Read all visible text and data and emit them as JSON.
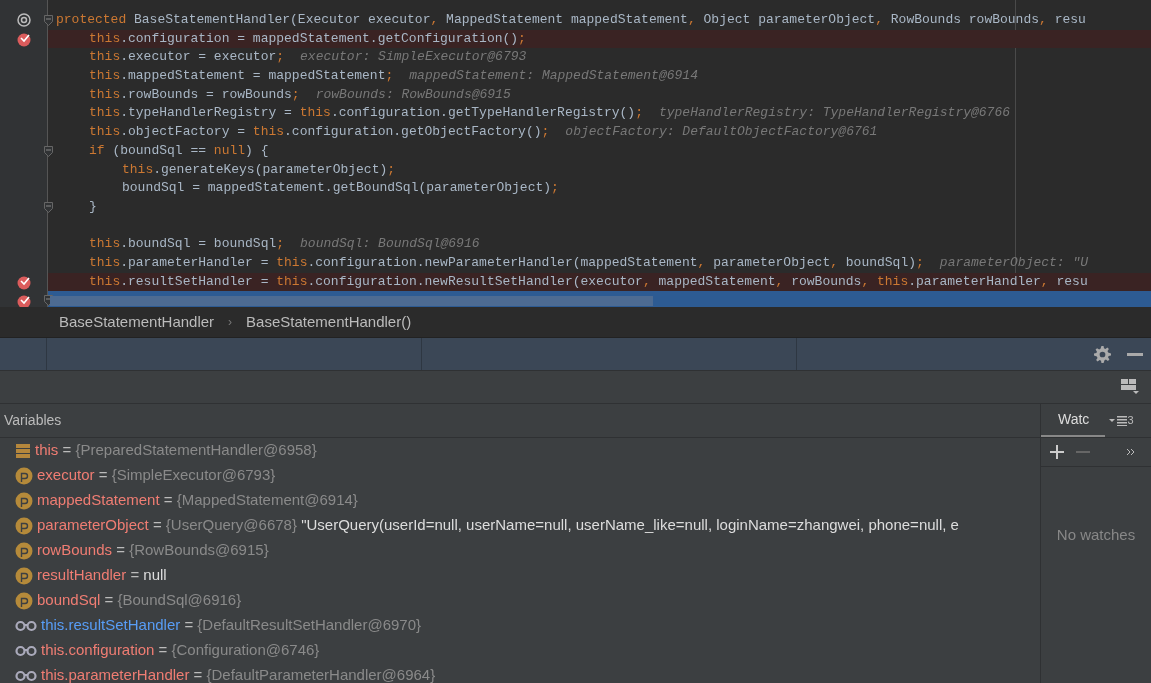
{
  "editor": {
    "lines": [
      {
        "implements": true,
        "breakpoint": false,
        "current": false,
        "fold": true,
        "segments": [
          {
            "text": "protected",
            "kind": "kw"
          },
          {
            "text": " BaseStatementHandler(Executor executor",
            "kind": "tx"
          },
          {
            "text": ",",
            "kind": "kw"
          },
          {
            "text": " MappedStatement mappedStatement",
            "kind": "tx"
          },
          {
            "text": ",",
            "kind": "kw"
          },
          {
            "text": " Object parameterObject",
            "kind": "tx"
          },
          {
            "text": ",",
            "kind": "kw"
          },
          {
            "text": " RowBounds rowBounds",
            "kind": "tx"
          },
          {
            "text": ",",
            "kind": "kw"
          },
          {
            "text": " resu",
            "kind": "tx"
          }
        ],
        "children": [
          {
            "implements": false,
            "breakpoint": true,
            "current": false,
            "fold": false,
            "segments": [
              {
                "text": "this",
                "kind": "kw"
              },
              {
                "text": ".configuration = mappedStatement.getConfiguration()",
                "kind": "tx"
              },
              {
                "text": ";",
                "kind": "kw"
              }
            ]
          },
          {
            "implements": false,
            "breakpoint": false,
            "current": false,
            "fold": false,
            "segments": [
              {
                "text": "this",
                "kind": "kw"
              },
              {
                "text": ".executor = executor",
                "kind": "tx"
              },
              {
                "text": ";",
                "kind": "kw"
              }
            ],
            "hint": "executor: SimpleExecutor@6793"
          },
          {
            "implements": false,
            "breakpoint": false,
            "current": false,
            "fold": false,
            "segments": [
              {
                "text": "this",
                "kind": "kw"
              },
              {
                "text": ".mappedStatement = mappedStatement",
                "kind": "tx"
              },
              {
                "text": ";",
                "kind": "kw"
              }
            ],
            "hint": "mappedStatement: MappedStatement@6914"
          },
          {
            "implements": false,
            "breakpoint": false,
            "current": false,
            "fold": false,
            "segments": [
              {
                "text": "this",
                "kind": "kw"
              },
              {
                "text": ".rowBounds = rowBounds",
                "kind": "tx"
              },
              {
                "text": ";",
                "kind": "kw"
              }
            ],
            "hint": "rowBounds: RowBounds@6915"
          },
          {
            "implements": false,
            "breakpoint": false,
            "current": false,
            "fold": false,
            "segments": [
              {
                "text": "this",
                "kind": "kw"
              },
              {
                "text": ".typeHandlerRegistry = ",
                "kind": "tx"
              },
              {
                "text": "this",
                "kind": "kw"
              },
              {
                "text": ".configuration.getTypeHandlerRegistry()",
                "kind": "tx"
              },
              {
                "text": ";",
                "kind": "kw"
              }
            ],
            "hint": "typeHandlerRegistry: TypeHandlerRegistry@6766"
          },
          {
            "implements": false,
            "breakpoint": false,
            "current": false,
            "fold": false,
            "segments": [
              {
                "text": "this",
                "kind": "kw"
              },
              {
                "text": ".objectFactory = ",
                "kind": "tx"
              },
              {
                "text": "this",
                "kind": "kw"
              },
              {
                "text": ".configuration.getObjectFactory()",
                "kind": "tx"
              },
              {
                "text": ";",
                "kind": "kw"
              }
            ],
            "hint": "objectFactory: DefaultObjectFactory@6761"
          },
          {
            "implements": false,
            "breakpoint": false,
            "current": false,
            "fold": true,
            "segments": [
              {
                "text": "if",
                "kind": "kw"
              },
              {
                "text": " (boundSql == ",
                "kind": "tx"
              },
              {
                "text": "null",
                "kind": "kw"
              },
              {
                "text": ") {",
                "kind": "tx"
              }
            ],
            "children": [
              {
                "implements": false,
                "breakpoint": false,
                "current": false,
                "fold": false,
                "segments": [
                  {
                    "text": "this",
                    "kind": "kw"
                  },
                  {
                    "text": ".generateKeys(parameterObject)",
                    "kind": "tx"
                  },
                  {
                    "text": ";",
                    "kind": "kw"
                  }
                ]
              },
              {
                "implements": false,
                "breakpoint": false,
                "current": false,
                "fold": false,
                "segments": [
                  {
                    "text": "boundSql = mappedStatement.getBoundSql(parameterObject)",
                    "kind": "tx"
                  },
                  {
                    "text": ";",
                    "kind": "kw"
                  }
                ]
              }
            ]
          },
          {
            "implements": false,
            "breakpoint": false,
            "current": false,
            "fold": true,
            "segments": [
              {
                "text": "}",
                "kind": "tx"
              }
            ]
          },
          {
            "implements": false,
            "breakpoint": false,
            "current": false,
            "fold": false
          },
          {
            "implements": false,
            "breakpoint": false,
            "current": false,
            "fold": false,
            "segments": [
              {
                "text": "this",
                "kind": "kw"
              },
              {
                "text": ".boundSql = boundSql",
                "kind": "tx"
              },
              {
                "text": ";",
                "kind": "kw"
              }
            ],
            "hint": "boundSql: BoundSql@6916"
          },
          {
            "implements": false,
            "breakpoint": false,
            "current": false,
            "fold": false,
            "segments": [
              {
                "text": "this",
                "kind": "kw"
              },
              {
                "text": ".parameterHandler = ",
                "kind": "tx"
              },
              {
                "text": "this",
                "kind": "kw"
              },
              {
                "text": ".configuration.newParameterHandler(mappedStatement",
                "kind": "tx"
              },
              {
                "text": ",",
                "kind": "kw"
              },
              {
                "text": " parameterObject",
                "kind": "tx"
              },
              {
                "text": ",",
                "kind": "kw"
              },
              {
                "text": " boundSql)",
                "kind": "tx"
              },
              {
                "text": ";",
                "kind": "kw"
              }
            ],
            "hint": "parameterObject: \"U"
          },
          {
            "implements": false,
            "breakpoint": true,
            "current": false,
            "fold": false,
            "segments": [
              {
                "text": "this",
                "kind": "kw"
              },
              {
                "text": ".resultSetHandler = ",
                "kind": "tx"
              },
              {
                "text": "this",
                "kind": "kw"
              },
              {
                "text": ".configuration.newResultSetHandler(executor",
                "kind": "tx"
              },
              {
                "text": ",",
                "kind": "kw"
              },
              {
                "text": " mappedStatement",
                "kind": "tx"
              },
              {
                "text": ",",
                "kind": "kw"
              },
              {
                "text": " rowBounds",
                "kind": "tx"
              },
              {
                "text": ",",
                "kind": "kw"
              },
              {
                "text": " this",
                "kind": "kw"
              },
              {
                "text": ".parameterHandler",
                "kind": "tx"
              },
              {
                "text": ",",
                "kind": "kw"
              },
              {
                "text": " resu",
                "kind": "tx"
              }
            ]
          }
        ]
      },
      {
        "implements": false,
        "breakpoint": true,
        "current": true,
        "fold": true
      }
    ]
  },
  "breadcrumbs": [
    "BaseStatementHandler",
    "›",
    "BaseStatementHandler()"
  ],
  "variables": {
    "title": "Variables",
    "items": [
      {
        "kind": "static",
        "name": "this",
        "operator": "=",
        "changed": false,
        "ref": "{PreparedStatementHandler@6958}"
      },
      {
        "kind": "param",
        "name": "executor",
        "operator": "=",
        "changed": false,
        "ref": "{SimpleExecutor@6793}"
      },
      {
        "kind": "param",
        "name": "mappedStatement",
        "operator": "=",
        "changed": false,
        "ref": "{MappedStatement@6914}"
      },
      {
        "kind": "param",
        "name": "parameterObject",
        "operator": "=",
        "changed": false,
        "ref": "{UserQuery@6678}",
        "value": "\"UserQuery(userId=null, userName=null, userName_like=null, loginName=zhangwei, phone=null, e"
      },
      {
        "kind": "param",
        "name": "rowBounds",
        "operator": "=",
        "changed": false,
        "ref": "{RowBounds@6915}"
      },
      {
        "kind": "param",
        "name": "resultHandler",
        "operator": "=",
        "changed": false,
        "value": "null"
      },
      {
        "kind": "param",
        "name": "boundSql",
        "operator": "=",
        "changed": false,
        "ref": "{BoundSql@6916}"
      },
      {
        "kind": "watch",
        "name": "this.resultSetHandler",
        "operator": "=",
        "changed": true,
        "ref": "{DefaultResultSetHandler@6970}"
      },
      {
        "kind": "watch",
        "name": "this.configuration",
        "operator": "=",
        "changed": false,
        "ref": "{Configuration@6746}"
      },
      {
        "kind": "watch",
        "name": "this.parameterHandler",
        "operator": "=",
        "changed": false,
        "ref": "{DefaultParameterHandler@6964}"
      }
    ]
  },
  "watches": {
    "tab": "Watc",
    "count": "3",
    "empty": "No watches"
  }
}
